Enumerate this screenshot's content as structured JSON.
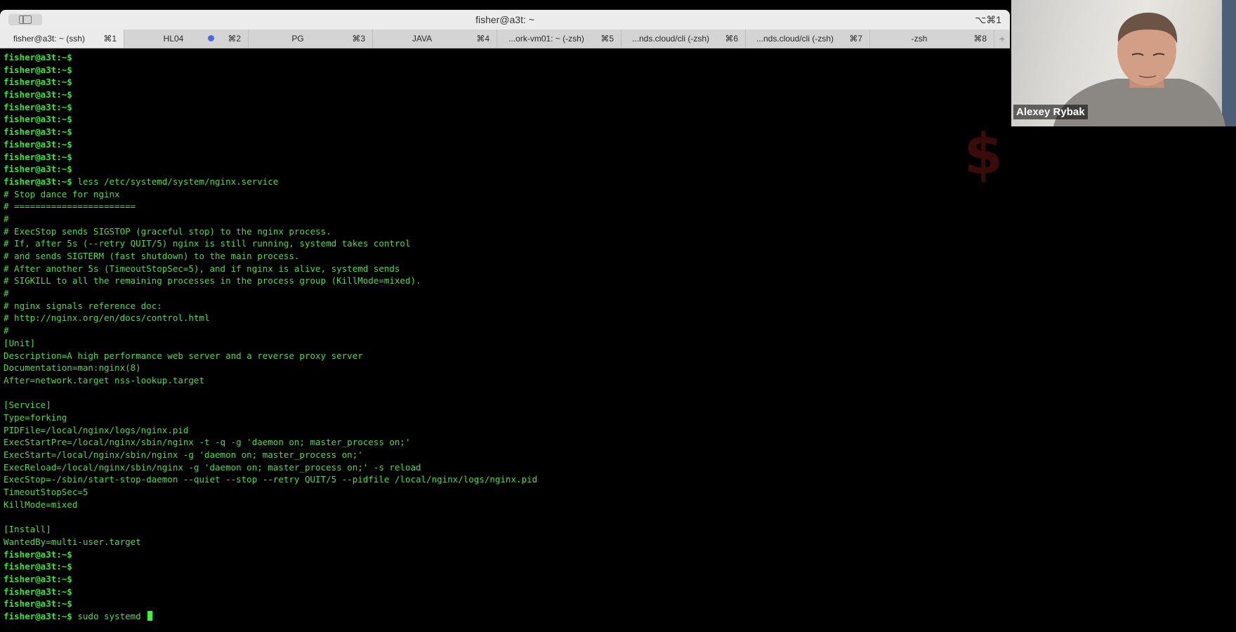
{
  "window": {
    "title": "fisher@a3t: ~",
    "shortcut": "⌥⌘1"
  },
  "tabs": [
    {
      "label": "fisher@a3t: ~ (ssh)",
      "shortcut": "⌘1",
      "active": true,
      "activity": false
    },
    {
      "label": "HL04",
      "shortcut": "⌘2",
      "active": false,
      "activity": true
    },
    {
      "label": "PG",
      "shortcut": "⌘3",
      "active": false,
      "activity": false
    },
    {
      "label": "JAVA",
      "shortcut": "⌘4",
      "active": false,
      "activity": false
    },
    {
      "label": "...ork-vm01: ~ (-zsh)",
      "shortcut": "⌘5",
      "active": false,
      "activity": false
    },
    {
      "label": "...nds.cloud/cli (-zsh)",
      "shortcut": "⌘6",
      "active": false,
      "activity": false
    },
    {
      "label": "...nds.cloud/cli (-zsh)",
      "shortcut": "⌘7",
      "active": false,
      "activity": false
    },
    {
      "label": "-zsh",
      "shortcut": "⌘8",
      "active": false,
      "activity": false
    }
  ],
  "new_tab_icon": "+",
  "watermark": "$",
  "terminal": {
    "prompt": "fisher@a3t:~$",
    "lines": [
      {
        "prompt": true,
        "text": ""
      },
      {
        "prompt": true,
        "text": ""
      },
      {
        "prompt": true,
        "text": ""
      },
      {
        "prompt": true,
        "text": ""
      },
      {
        "prompt": true,
        "text": ""
      },
      {
        "prompt": true,
        "text": ""
      },
      {
        "prompt": true,
        "text": ""
      },
      {
        "prompt": true,
        "text": ""
      },
      {
        "prompt": true,
        "text": ""
      },
      {
        "prompt": true,
        "text": ""
      },
      {
        "prompt": true,
        "text": " less /etc/systemd/system/nginx.service"
      },
      {
        "prompt": false,
        "text": "# Stop dance for nginx"
      },
      {
        "prompt": false,
        "text": "# ======================="
      },
      {
        "prompt": false,
        "text": "#"
      },
      {
        "prompt": false,
        "text": "# ExecStop sends SIGSTOP (graceful stop) to the nginx process."
      },
      {
        "prompt": false,
        "text": "# If, after 5s (--retry QUIT/5) nginx is still running, systemd takes control"
      },
      {
        "prompt": false,
        "text": "# and sends SIGTERM (fast shutdown) to the main process."
      },
      {
        "prompt": false,
        "text": "# After another 5s (TimeoutStopSec=5), and if nginx is alive, systemd sends"
      },
      {
        "prompt": false,
        "text": "# SIGKILL to all the remaining processes in the process group (KillMode=mixed)."
      },
      {
        "prompt": false,
        "text": "#"
      },
      {
        "prompt": false,
        "text": "# nginx signals reference doc:"
      },
      {
        "prompt": false,
        "text": "# http://nginx.org/en/docs/control.html"
      },
      {
        "prompt": false,
        "text": "#"
      },
      {
        "prompt": false,
        "text": "[Unit]"
      },
      {
        "prompt": false,
        "text": "Description=A high performance web server and a reverse proxy server"
      },
      {
        "prompt": false,
        "text": "Documentation=man:nginx(8)"
      },
      {
        "prompt": false,
        "text": "After=network.target nss-lookup.target"
      },
      {
        "prompt": false,
        "text": ""
      },
      {
        "prompt": false,
        "text": "[Service]"
      },
      {
        "prompt": false,
        "text": "Type=forking"
      },
      {
        "prompt": false,
        "text": "PIDFile=/local/nginx/logs/nginx.pid"
      },
      {
        "prompt": false,
        "text": "ExecStartPre=/local/nginx/sbin/nginx -t -q -g 'daemon on; master_process on;'"
      },
      {
        "prompt": false,
        "text": "ExecStart=/local/nginx/sbin/nginx -g 'daemon on; master_process on;'"
      },
      {
        "prompt": false,
        "text": "ExecReload=/local/nginx/sbin/nginx -g 'daemon on; master_process on;' -s reload"
      },
      {
        "prompt": false,
        "text": "ExecStop=-/sbin/start-stop-daemon --quiet --stop --retry QUIT/5 --pidfile /local/nginx/logs/nginx.pid"
      },
      {
        "prompt": false,
        "text": "TimeoutStopSec=5"
      },
      {
        "prompt": false,
        "text": "KillMode=mixed"
      },
      {
        "prompt": false,
        "text": ""
      },
      {
        "prompt": false,
        "text": "[Install]"
      },
      {
        "prompt": false,
        "text": "WantedBy=multi-user.target"
      },
      {
        "prompt": true,
        "text": ""
      },
      {
        "prompt": true,
        "text": ""
      },
      {
        "prompt": true,
        "text": ""
      },
      {
        "prompt": true,
        "text": ""
      },
      {
        "prompt": true,
        "text": ""
      },
      {
        "prompt": true,
        "text": " sudo systemd ",
        "cursor": true
      }
    ]
  },
  "video": {
    "participant_name": "Alexey Rybak"
  },
  "colors": {
    "terminal_text": "#53d651",
    "terminal_bg": "#000000",
    "tab_bar": "#d4d4d4",
    "active_tab": "#ebebeb",
    "activity_dot": "#4a68e0"
  }
}
